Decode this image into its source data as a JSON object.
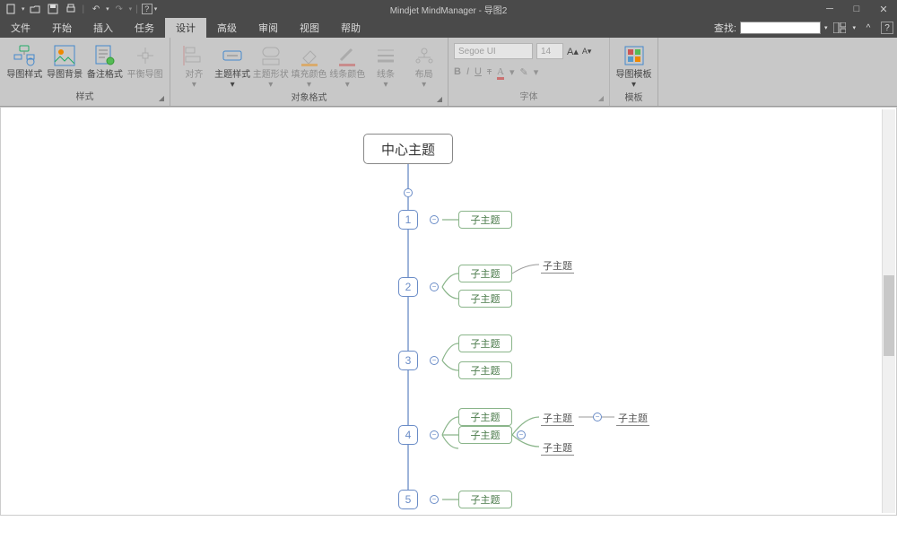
{
  "title": "Mindjet MindManager - 导图2",
  "menu": {
    "tabs": [
      "文件",
      "开始",
      "插入",
      "任务",
      "设计",
      "高级",
      "审阅",
      "视图",
      "帮助"
    ],
    "activeIndex": 4,
    "search_label": "查找:"
  },
  "ribbon": {
    "grp1": {
      "label": "样式",
      "items": [
        "导图样式",
        "导图背景",
        "备注格式",
        "平衡导图"
      ]
    },
    "grp2": {
      "label": "对象格式",
      "items": [
        "对齐",
        "主题样式",
        "主题形状",
        "填充颜色",
        "线条颜色",
        "线条",
        "布局"
      ]
    },
    "grp3": {
      "label": "字体",
      "font_name": "Segoe UI",
      "font_size": "14"
    },
    "grp4": {
      "label": "模板",
      "item": "导图模板"
    }
  },
  "mindmap": {
    "central": "中心主题",
    "mains": [
      "1",
      "2",
      "3",
      "4",
      "5"
    ],
    "sub": "子主题"
  }
}
